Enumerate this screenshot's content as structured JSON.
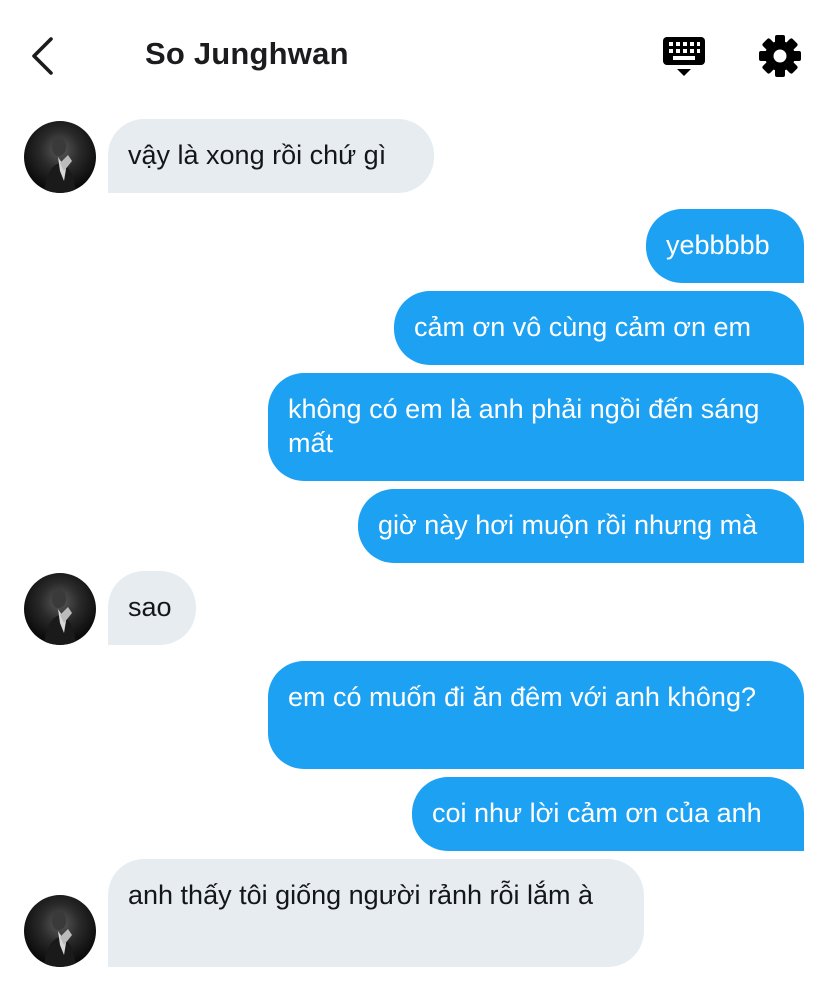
{
  "header": {
    "back_icon": "chevron-left-icon",
    "title": "So Junghwan",
    "keyboard_icon": "keyboard-icon",
    "settings_icon": "gear-icon"
  },
  "colors": {
    "outgoing_bubble": "#1da1f2",
    "incoming_bubble": "#e6ecf0",
    "outgoing_text": "#ffffff",
    "incoming_text": "#14171a"
  },
  "messages": [
    {
      "direction": "incoming",
      "text": "vậy là xong rồi chứ gì"
    },
    {
      "direction": "outgoing",
      "text": "yebbbbb"
    },
    {
      "direction": "outgoing",
      "text": "cảm ơn vô cùng cảm ơn em"
    },
    {
      "direction": "outgoing",
      "text": "không có em là anh phải ngồi đến sáng mất"
    },
    {
      "direction": "outgoing",
      "text": "giờ này hơi muộn rồi nhưng mà"
    },
    {
      "direction": "incoming",
      "text": "sao"
    },
    {
      "direction": "outgoing",
      "text": "em có muốn đi ăn đêm với anh không?"
    },
    {
      "direction": "outgoing",
      "text": "coi như lời cảm ơn của anh"
    },
    {
      "direction": "incoming",
      "text": "anh thấy tôi giống người rảnh rỗi lắm à"
    }
  ]
}
